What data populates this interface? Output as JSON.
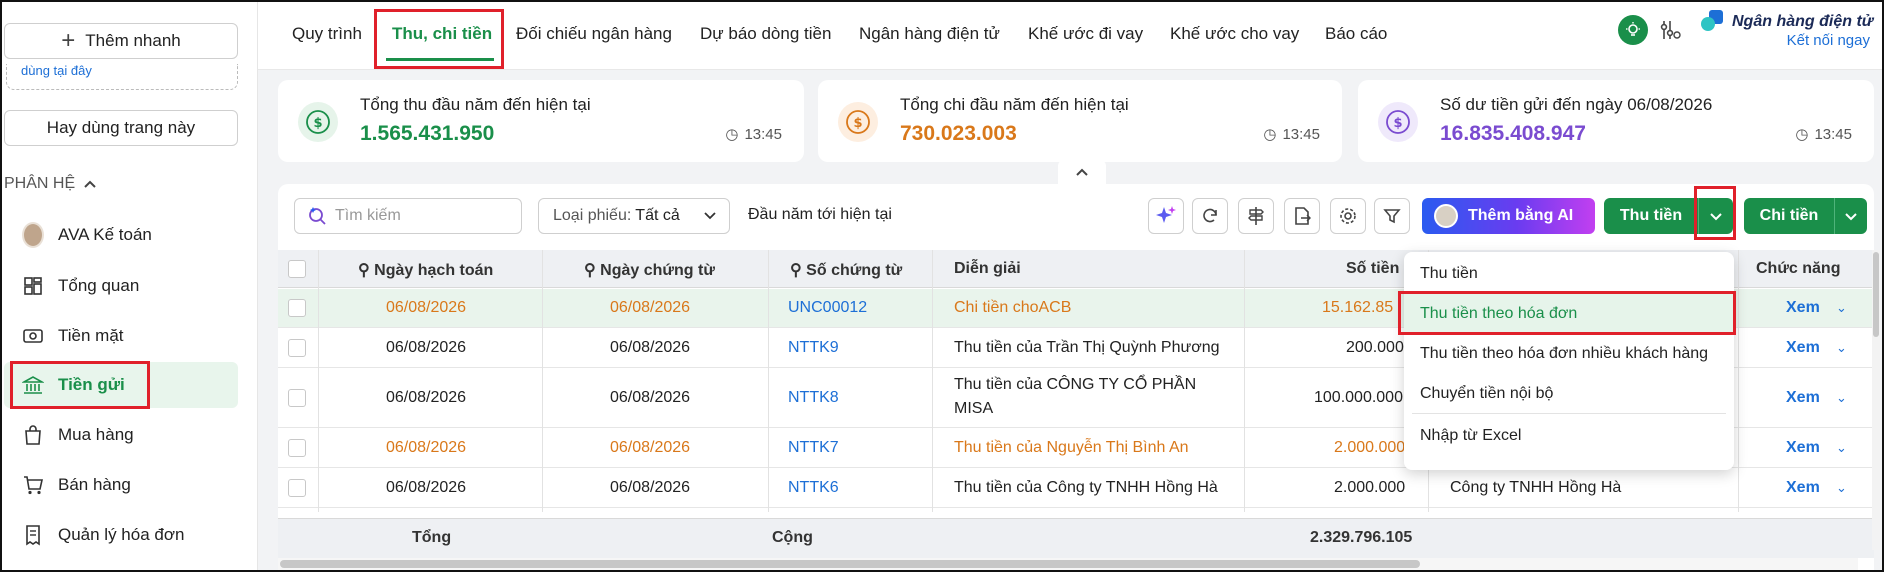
{
  "sidebar": {
    "quick_add": "Thêm nhanh",
    "dashed_hint": "dùng tại đây",
    "common_page": "Hay dùng trang này",
    "section": "PHÂN HỆ",
    "items": [
      {
        "label": "AVA Kế toán",
        "icon": "avatar"
      },
      {
        "label": "Tổng quan",
        "icon": "dashboard-icon"
      },
      {
        "label": "Tiền mặt",
        "icon": "cash-icon"
      },
      {
        "label": "Tiền gửi",
        "icon": "bank-icon"
      },
      {
        "label": "Mua hàng",
        "icon": "shopping-bag-icon"
      },
      {
        "label": "Bán hàng",
        "icon": "cart-icon"
      },
      {
        "label": "Quản lý hóa đơn",
        "icon": "invoice-icon"
      }
    ]
  },
  "topnav": {
    "tabs": [
      "Quy trình",
      "Thu, chi tiền",
      "Đối chiếu ngân hàng",
      "Dự báo dòng tiền",
      "Ngân hàng điện tử",
      "Khế ước đi vay",
      "Khế ước cho vay",
      "Báo cáo"
    ],
    "active_tab": "Thu, chi tiền",
    "bank_title": "Ngân hàng điện tử",
    "bank_link": "Kết nối ngay"
  },
  "stats": [
    {
      "label": "Tổng thu đầu năm đến hiện tại",
      "value": "1.565.431.950",
      "time": "13:45",
      "color": "#1a8f4a"
    },
    {
      "label": "Tổng chi đầu năm đến hiện tại",
      "value": "730.023.003",
      "time": "13:45",
      "color": "#d9781a"
    },
    {
      "label": "Số dư tiền gửi đến ngày 06/08/2026",
      "value": "16.835.408.947",
      "time": "13:45",
      "color": "#7a4bd0"
    }
  ],
  "toolbar": {
    "search_placeholder": "Tìm kiếm",
    "filter_label": "Loại phiếu:",
    "filter_value": "Tất cả",
    "period": "Đầu năm tới hiện tại",
    "ai_button": "Thêm bằng AI",
    "receive_button": "Thu tiền",
    "pay_button": "Chi tiền"
  },
  "table": {
    "headers": {
      "date_post": "Ngày hạch toán",
      "date_doc": "Ngày chứng từ",
      "doc_no": "Số chứng từ",
      "desc": "Diễn giải",
      "amount": "Số tiền",
      "actions": "Chức năng"
    },
    "rows": [
      {
        "date_post": "06/08/2026",
        "date_doc": "06/08/2026",
        "doc_no": "UNC00012",
        "desc": "Chi tiền choACB",
        "desc2": "",
        "amount": "15.162.85",
        "partner": "",
        "action": "Xem"
      },
      {
        "date_post": "06/08/2026",
        "date_doc": "06/08/2026",
        "doc_no": "NTTK9",
        "desc": "Thu tiền của Trần Thị Quỳnh Phương",
        "desc2": "",
        "amount": "200.000",
        "partner": "",
        "action": "Xem"
      },
      {
        "date_post": "06/08/2026",
        "date_doc": "06/08/2026",
        "doc_no": "NTTK8",
        "desc": "Thu tiền của CÔNG TY CỔ PHẦN",
        "desc2": "MISA",
        "amount": "100.000.000",
        "partner": "",
        "action": "Xem"
      },
      {
        "date_post": "06/08/2026",
        "date_doc": "06/08/2026",
        "doc_no": "NTTK7",
        "desc": "Thu tiền của Nguyễn Thị Bình An",
        "desc2": "",
        "amount": "2.000.000",
        "partner": "",
        "action": "Xem"
      },
      {
        "date_post": "06/08/2026",
        "date_doc": "06/08/2026",
        "doc_no": "NTTK6",
        "desc": "Thu tiền của Công ty TNHH Hồng Hà",
        "desc2": "",
        "amount": "2.000.000",
        "partner": "Công ty TNHH Hồng Hà",
        "action": "Xem"
      }
    ],
    "footer": {
      "total": "Tổng",
      "sum": "Cộng",
      "amount": "2.329.796.105"
    }
  },
  "dropdown": {
    "items": [
      "Thu tiền",
      "Thu tiền theo hóa đơn",
      "Thu tiền theo hóa đơn nhiều khách hàng",
      "Chuyển tiền nội bộ",
      "Nhập từ Excel"
    ],
    "active": "Thu tiền theo hóa đơn"
  },
  "colors": {
    "brand_green": "#1a8f4a",
    "orange": "#d9781a",
    "link_blue": "#1d6fd6",
    "highlight_red": "#e0202a"
  }
}
